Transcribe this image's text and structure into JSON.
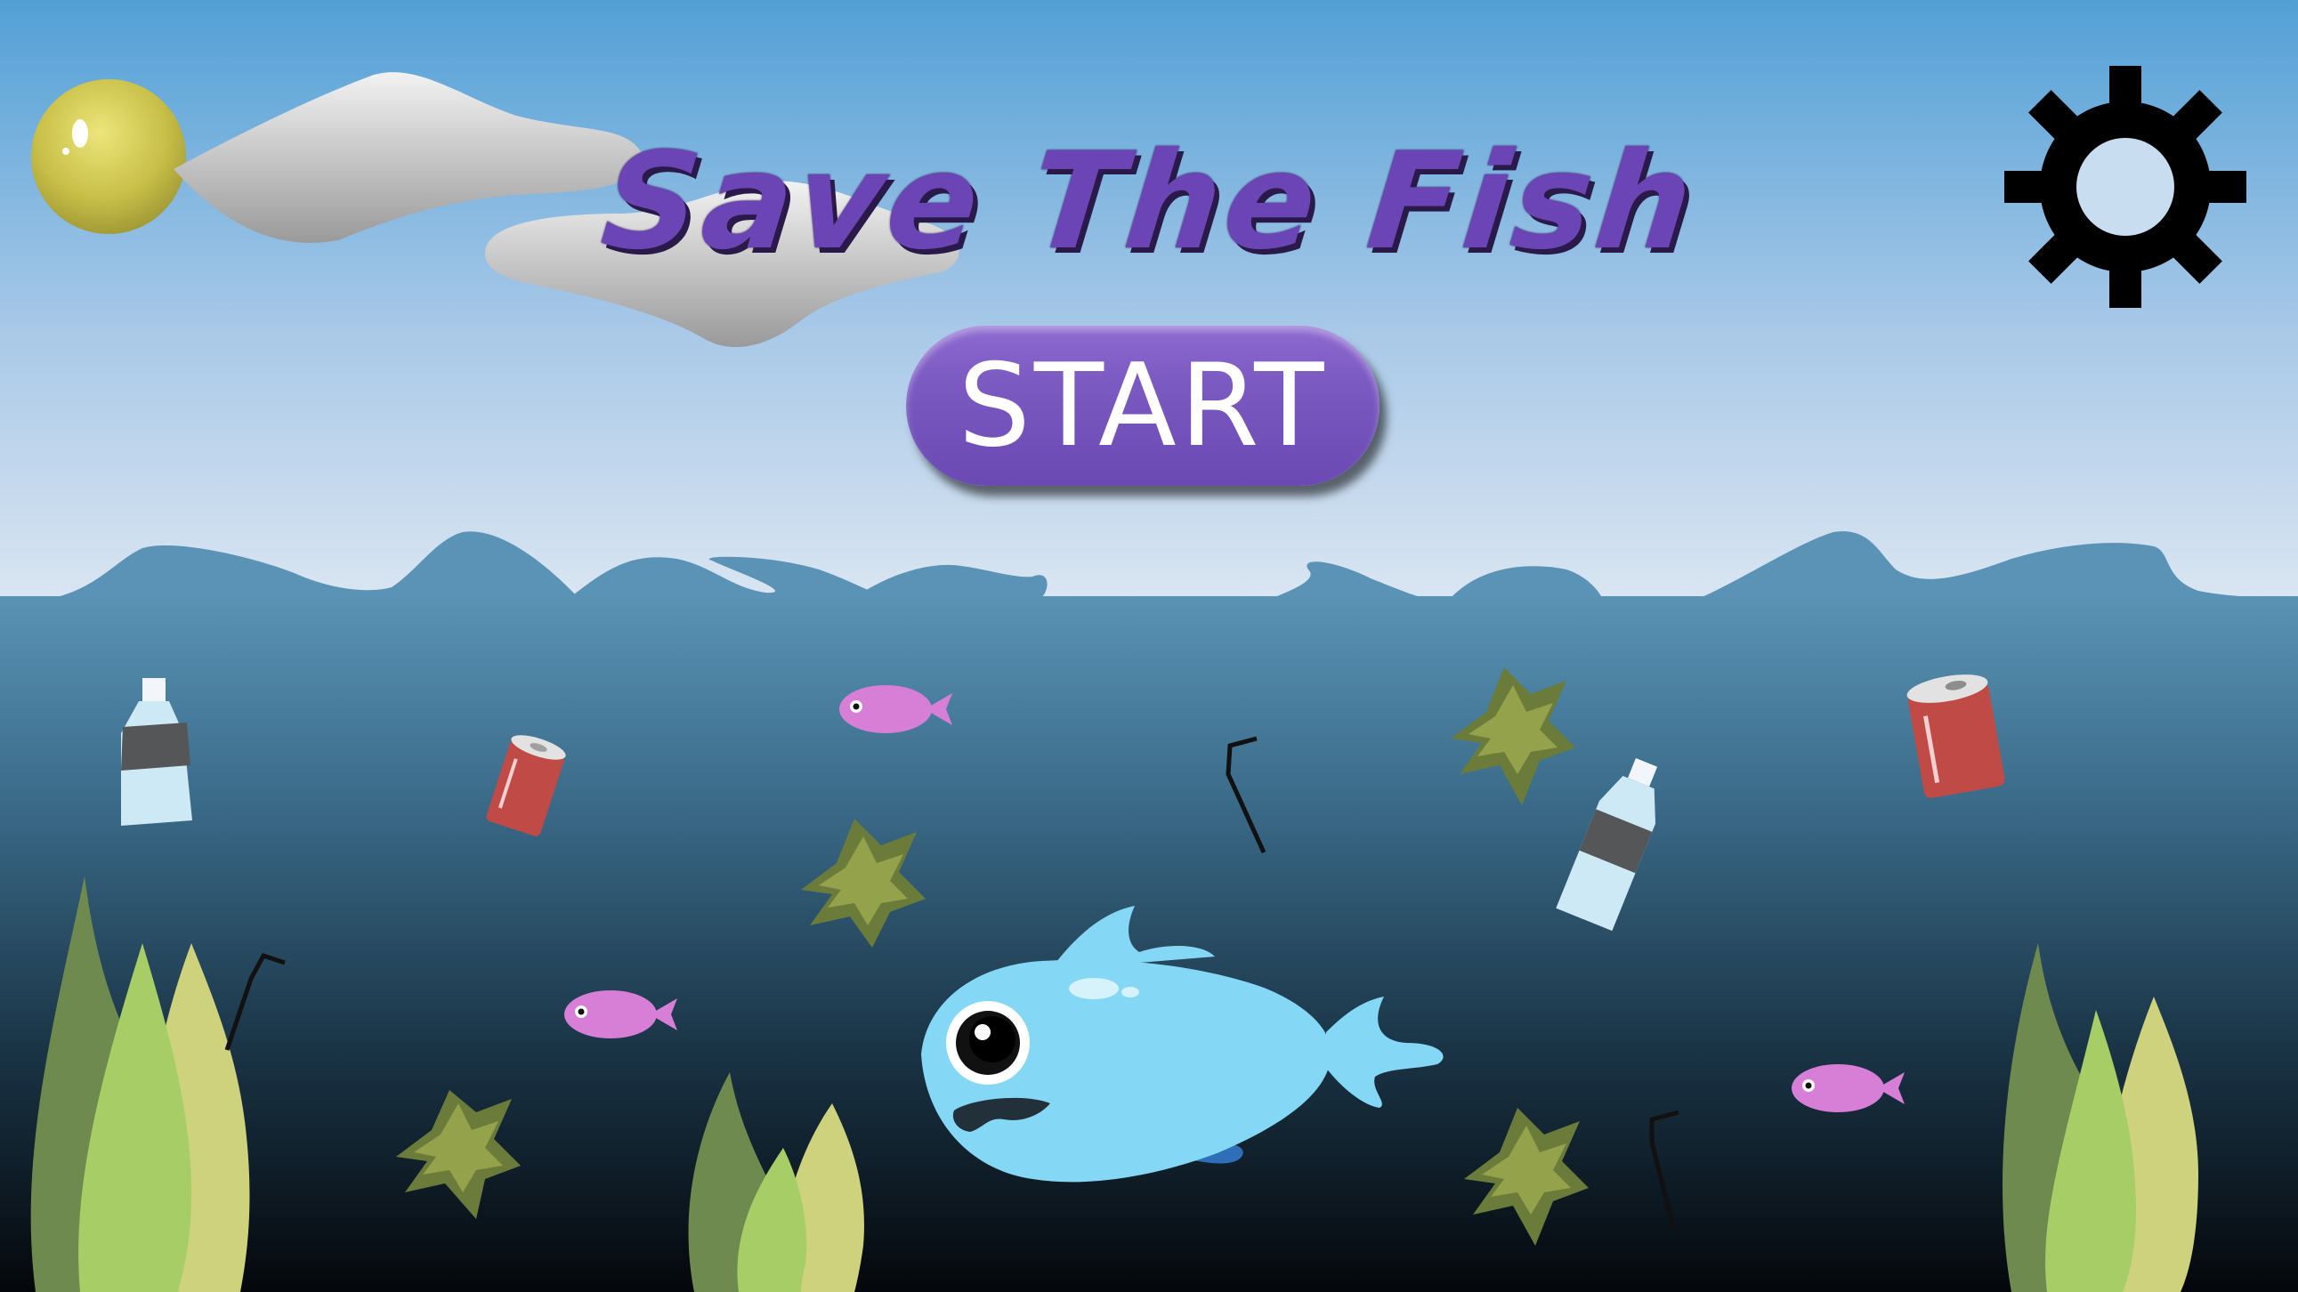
{
  "game": {
    "title": "Save The Fish",
    "start_label": "START"
  },
  "icons": {
    "settings": "gear-icon",
    "sun": "sun-icon"
  },
  "colors": {
    "sky_top": "#56a2d6",
    "sky_bottom": "#d5e3f1",
    "water_top": "#5b93b4",
    "water_bottom": "#060a10",
    "title": "#6b45b5",
    "button": "#7b5ac2",
    "player_fish": "#85d8f5",
    "small_fish": "#d77ed7",
    "can": "#c04a46",
    "seaweed_light": "#a7cd67",
    "seaweed_dark": "#6f8a4e",
    "seaweed_yellow": "#cfd27c"
  }
}
